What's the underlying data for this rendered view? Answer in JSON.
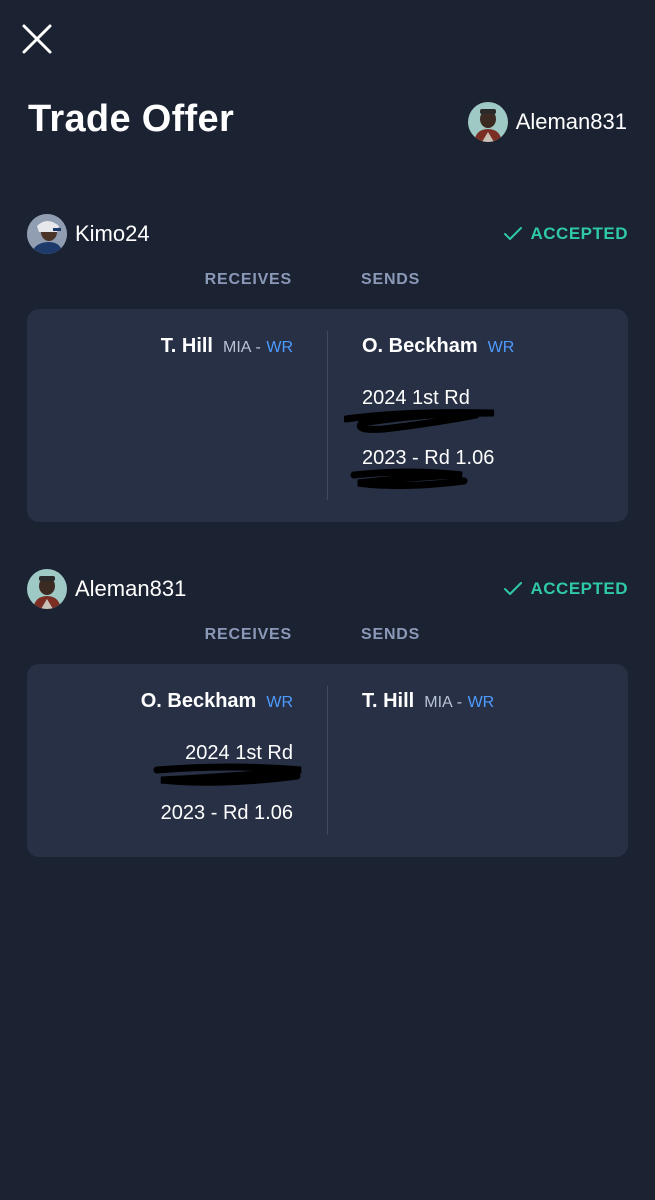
{
  "header": {
    "title": "Trade Offer",
    "user": "Aleman831",
    "close_icon": "close-icon"
  },
  "colors": {
    "background": "#1b2232",
    "card": "#273044",
    "accepted": "#2fc9a5",
    "position": "#4e9bff",
    "label": "#8b99b8"
  },
  "labels": {
    "receives": "RECEIVES",
    "sends": "SENDS",
    "accepted": "ACCEPTED"
  },
  "parties": [
    {
      "user": "Kimo24",
      "status": "ACCEPTED",
      "receives": [
        {
          "name": "T. Hill",
          "team": "MIA",
          "pos": "WR"
        }
      ],
      "sends": [
        {
          "name": "O. Beckham",
          "pos": "WR"
        },
        {
          "pick": "2024 1st Rd"
        },
        {
          "pick": "2023 - Rd 1.06"
        }
      ]
    },
    {
      "user": "Aleman831",
      "status": "ACCEPTED",
      "receives": [
        {
          "name": "O. Beckham",
          "pos": "WR"
        },
        {
          "pick": "2024 1st Rd"
        },
        {
          "pick": "2023 - Rd 1.06"
        }
      ],
      "sends": [
        {
          "name": "T. Hill",
          "team": "MIA",
          "pos": "WR"
        }
      ]
    }
  ]
}
